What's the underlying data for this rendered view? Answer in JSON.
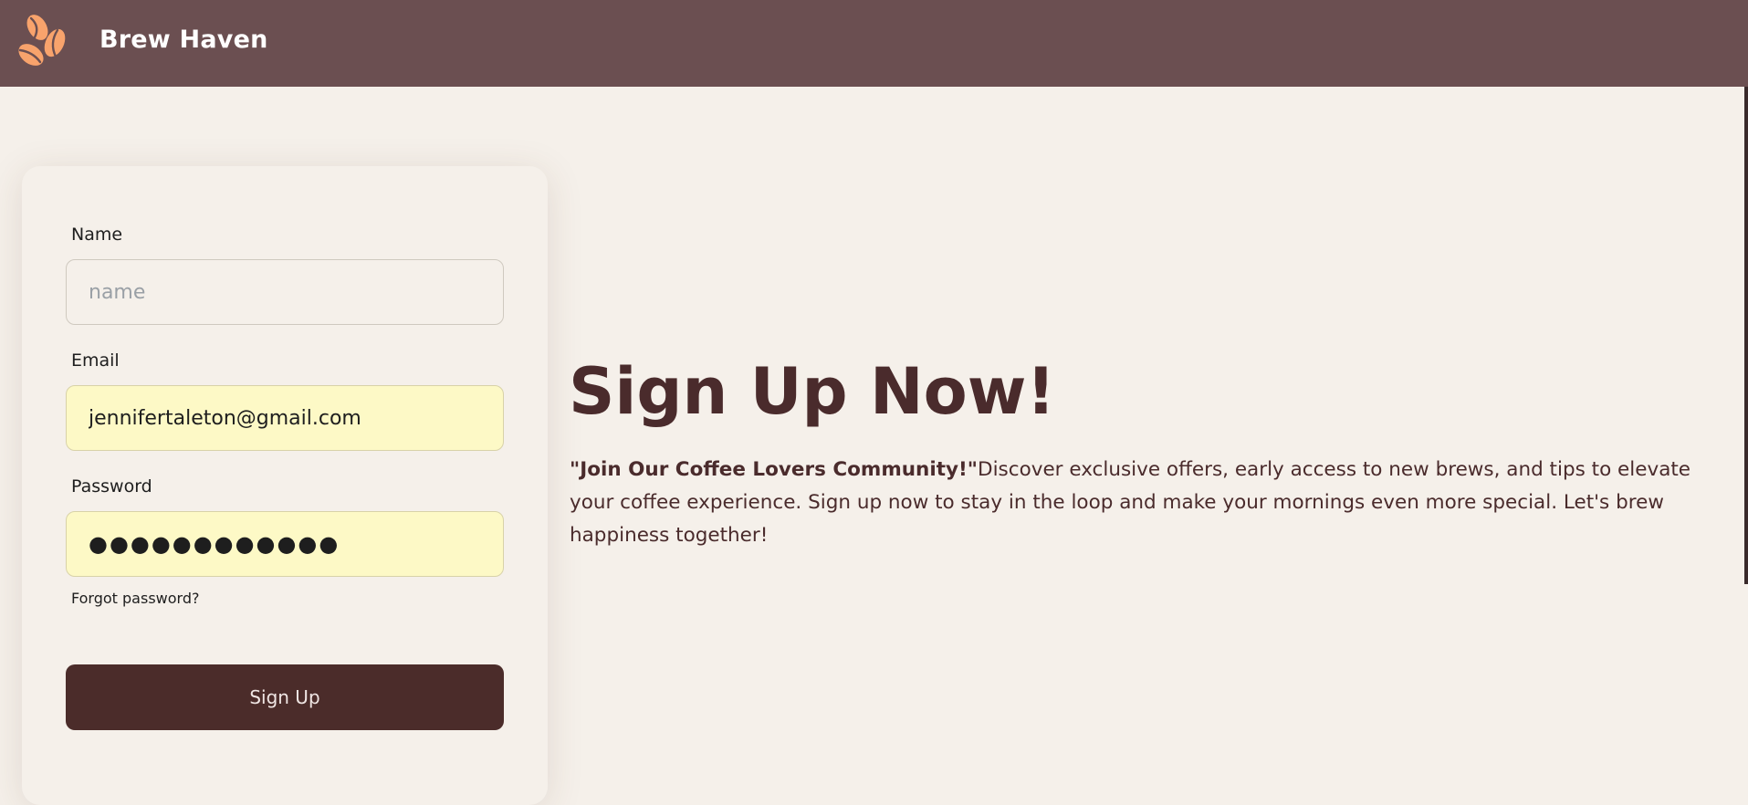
{
  "header": {
    "logo_icon": "coffee-beans-icon",
    "brand": "Brew Haven"
  },
  "form": {
    "name_label": "Name",
    "name_placeholder": "name",
    "name_value": "",
    "email_label": "Email",
    "email_value": "jennifertaleton@gmail.com",
    "password_label": "Password",
    "password_value": "●●●●●●●●●●●●",
    "forgot_label": "Forgot password?",
    "submit_label": "Sign Up"
  },
  "hero": {
    "title": "Sign Up Now!",
    "tagline": "\"Join Our Coffee Lovers Community!\"",
    "body": "Discover exclusive offers, early access to new brews, and tips to elevate your coffee experience. Sign up now to stay in the loop and make your mornings even more special. Let's brew happiness together!"
  },
  "colors": {
    "header_bg": "#6b4f51",
    "page_bg": "#f5f0ea",
    "accent": "#4b2c2a",
    "logo": "#f8a36c",
    "autofill_bg": "#fdf9c6"
  }
}
